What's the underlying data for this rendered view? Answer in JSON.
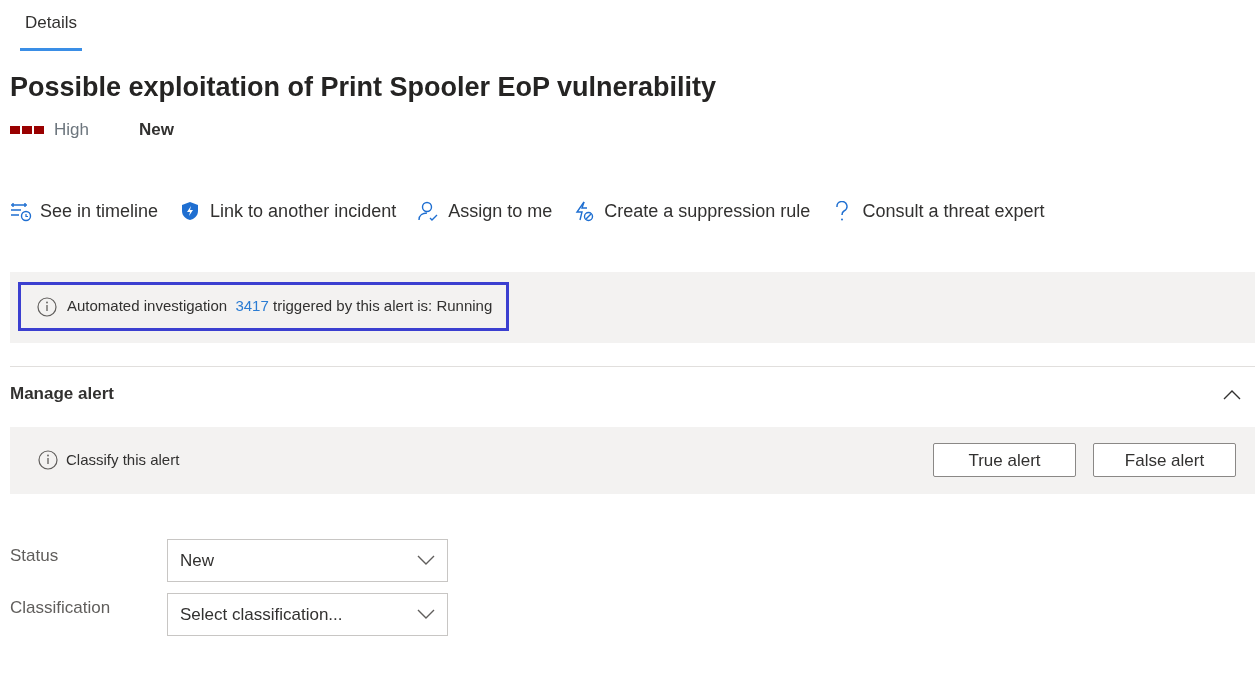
{
  "tabs": [
    {
      "label": "Details",
      "selected": true
    }
  ],
  "title": "Possible exploitation of Print Spooler EoP vulnerability",
  "severity": "High",
  "status_label": "New",
  "actions": [
    {
      "label": "See in timeline"
    },
    {
      "label": "Link to another incident"
    },
    {
      "label": "Assign to me"
    },
    {
      "label": "Create a suppression rule"
    },
    {
      "label": "Consult a threat expert"
    }
  ],
  "banner": {
    "text_before": "Automated investigation",
    "link": "3417",
    "text_after": "triggered by this alert is: Running",
    "highlighted": true
  },
  "manage_alert": {
    "title": "Manage alert",
    "expanded": true,
    "classify": {
      "text": "Classify this alert",
      "buttons": [
        "True alert",
        "False alert"
      ]
    },
    "fields": [
      {
        "label": "Status",
        "value": "New"
      },
      {
        "label": "Classification",
        "placeholder": "Select classification..."
      }
    ]
  }
}
